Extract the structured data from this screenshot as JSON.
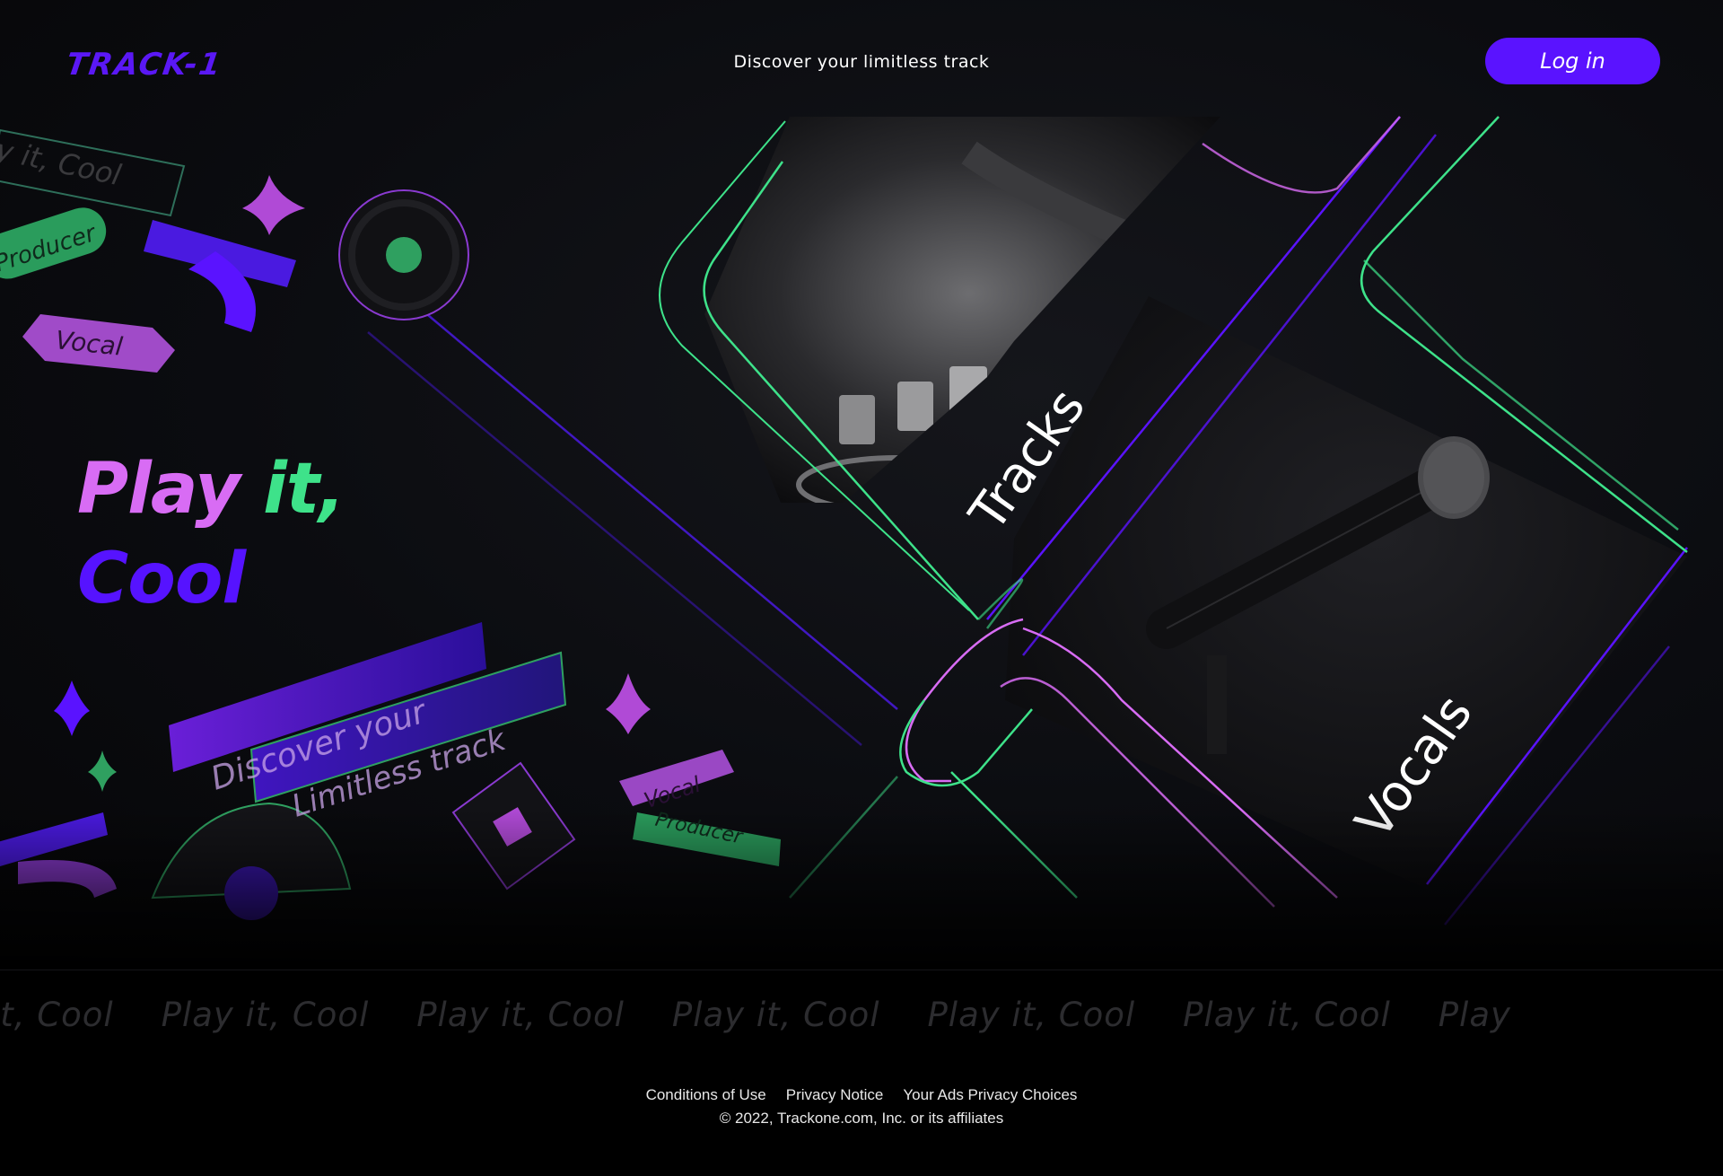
{
  "header": {
    "logo_text": "TRACK-1",
    "tagline": "Discover your limitless track",
    "login_label": "Log in"
  },
  "hero": {
    "headline_play": "Play",
    "headline_it": " it,",
    "headline_cool": "Cool",
    "sticker_tags": [
      "y it, Cool",
      "Producer",
      "Vocal",
      "Vocal",
      "Producer"
    ],
    "banner_line1": "Discover your",
    "banner_line2": "Limitless track",
    "cards": [
      {
        "label": "Tracks"
      },
      {
        "label": "Vocals"
      }
    ]
  },
  "ticker": {
    "items": [
      "Play it, Cool",
      "Play it, Cool",
      "Play it, Cool",
      "Play it, Cool",
      "Play it, Cool",
      "Play it, Cool",
      "Play"
    ]
  },
  "footer": {
    "links": [
      "Conditions of Use",
      "Privacy Notice",
      "Your Ads Privacy Choices"
    ],
    "copyright": "© 2022, Trackone.com, Inc. or its affiliates"
  },
  "colors": {
    "brand_purple": "#5a13ff",
    "pink": "#d86cf4",
    "green": "#3ee28a",
    "background": "#0b0c10"
  }
}
